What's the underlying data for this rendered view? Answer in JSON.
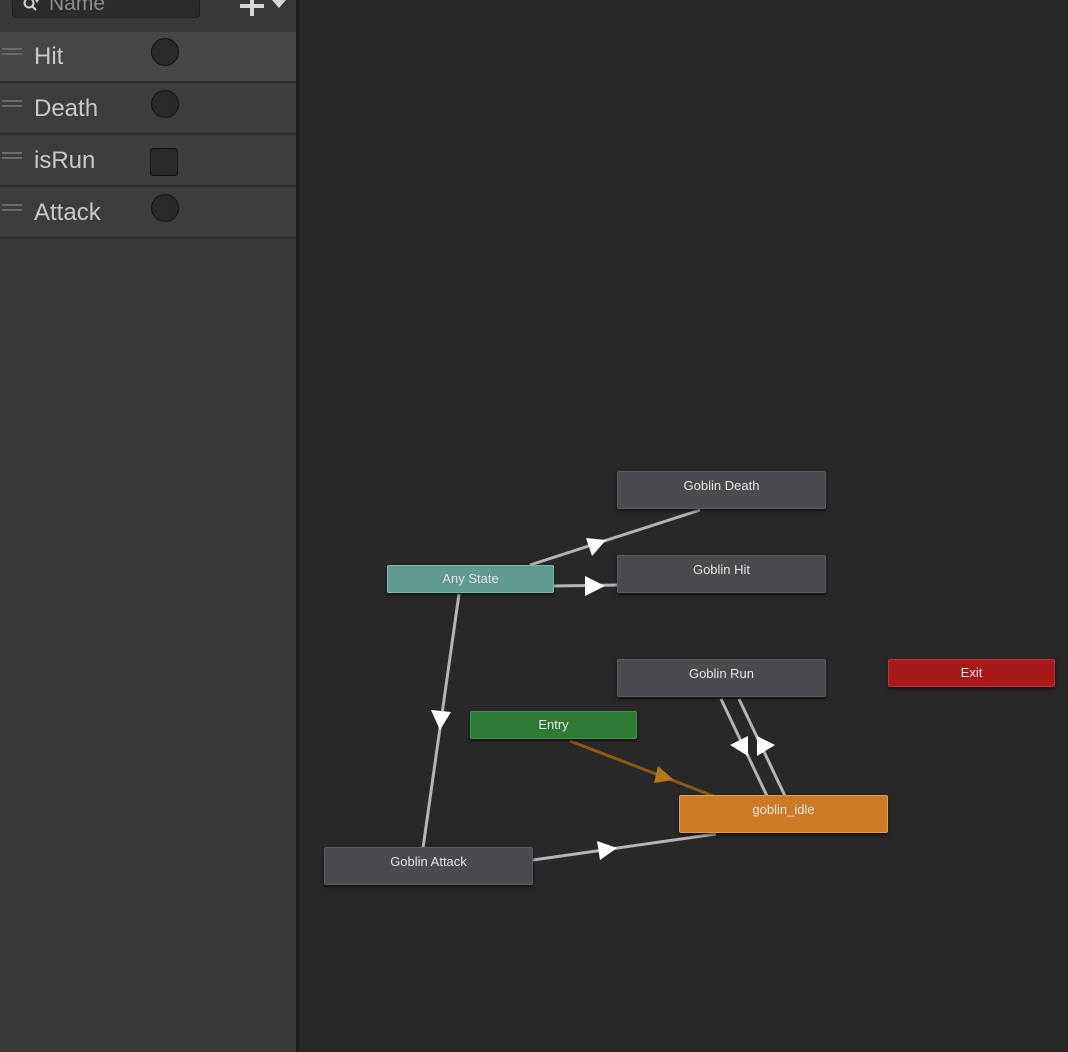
{
  "search": {
    "placeholder": "Name"
  },
  "parameters": [
    {
      "name": "Hit",
      "type": "trigger"
    },
    {
      "name": "Death",
      "type": "trigger"
    },
    {
      "name": "isRun",
      "type": "bool"
    },
    {
      "name": "Attack",
      "type": "trigger"
    }
  ],
  "states": {
    "goblin_death": "Goblin Death",
    "goblin_hit": "Goblin Hit",
    "any_state": "Any State",
    "goblin_run": "Goblin Run",
    "exit": "Exit",
    "entry": "Entry",
    "goblin_idle": "goblin_idle",
    "goblin_attack": "Goblin Attack"
  },
  "colors": {
    "default_state": "#cc7a24",
    "any_state": "#5e9a8f",
    "entry": "#2d7a34",
    "exit": "#a81919",
    "normal_state": "#4a4a4f",
    "default_transition": "#8a5a12",
    "transition": "#b4b4b4"
  }
}
